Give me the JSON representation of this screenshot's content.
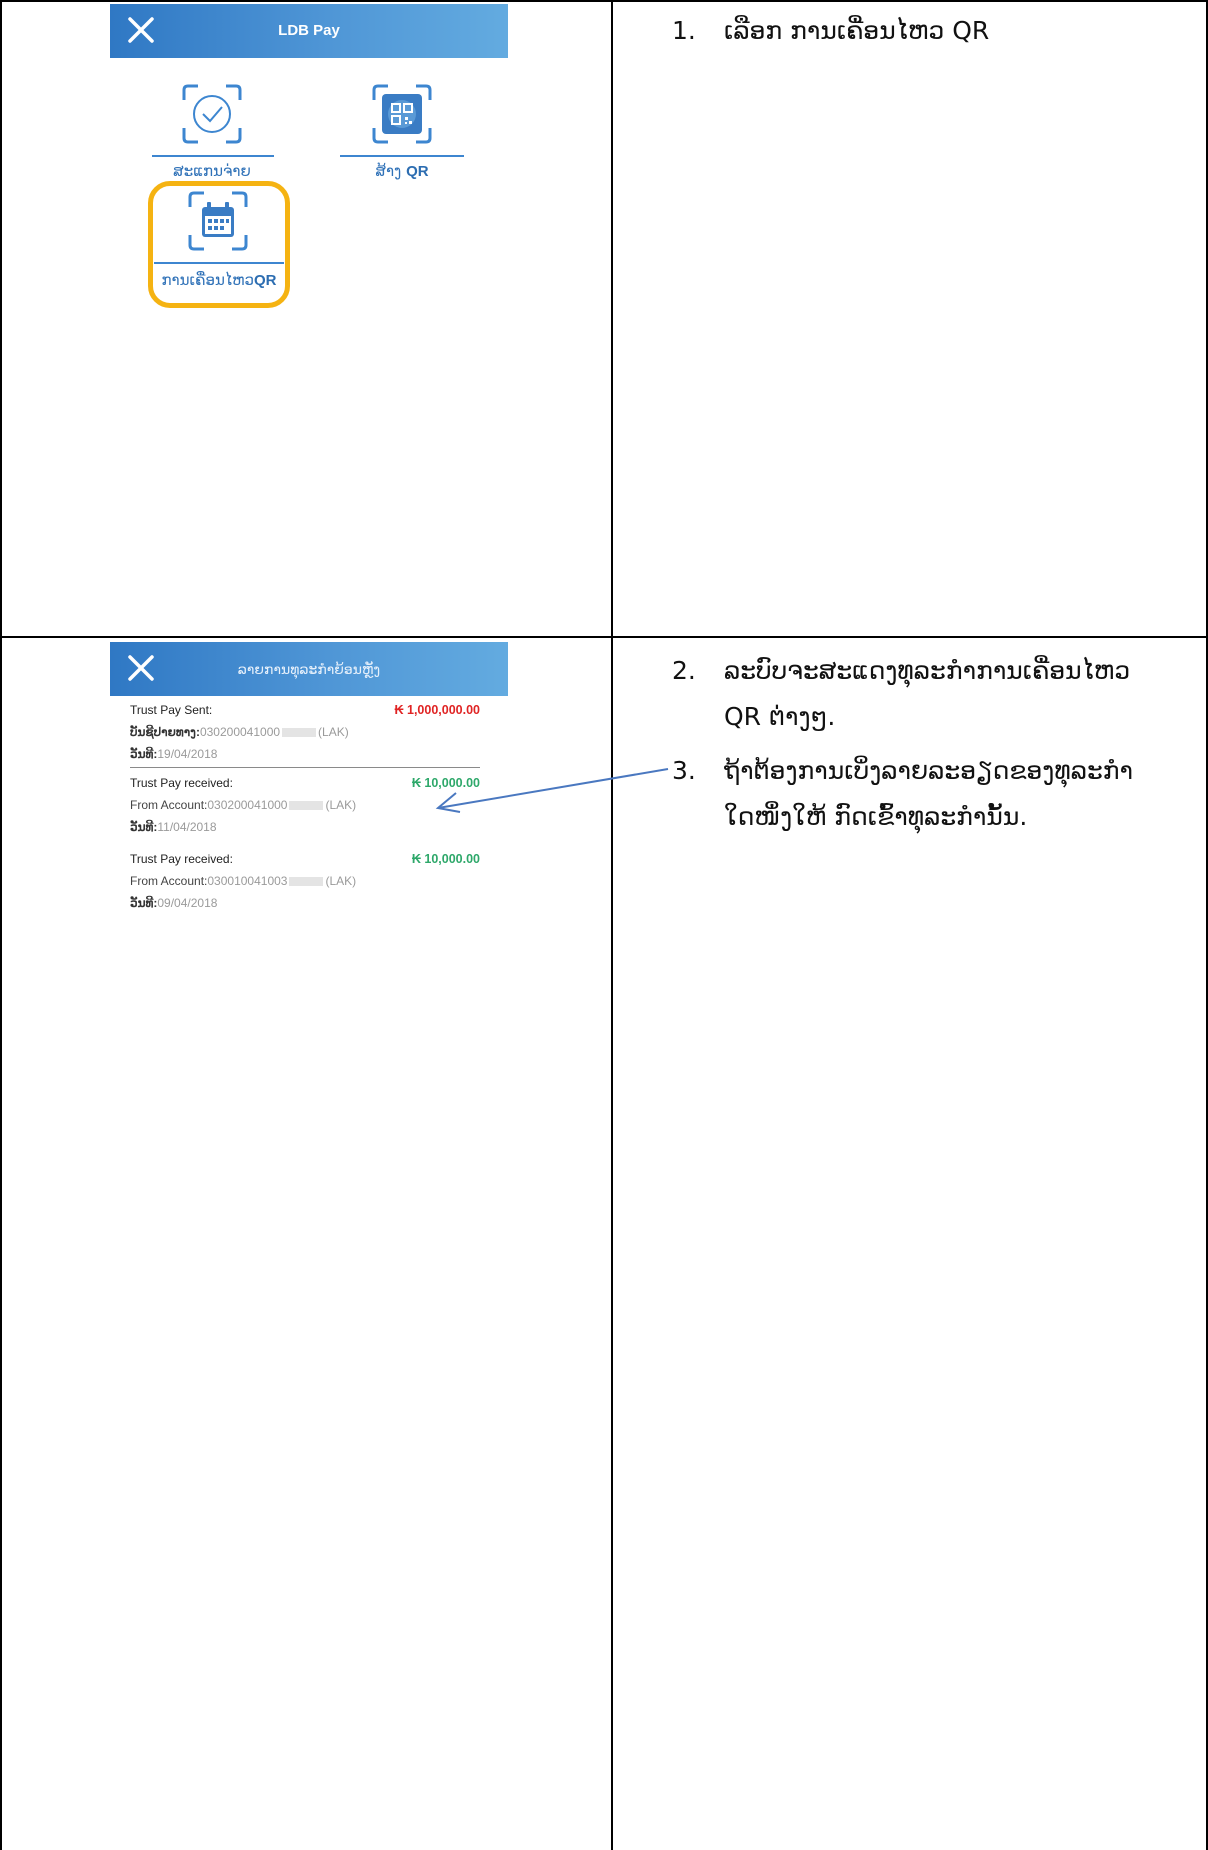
{
  "row1": {
    "header_title": "LDB Pay",
    "tiles": [
      {
        "label": "ສະແກນຈ່າຍ",
        "icon": "check-circle-icon"
      },
      {
        "label": "ສ້າງ ",
        "label_bold": "QR",
        "icon": "qr-code-icon"
      },
      {
        "label": "ການເຄື່ອນໄຫວ",
        "label_bold": "QR",
        "icon": "calendar-icon"
      }
    ],
    "instruction_num": "1.",
    "instruction_text": "ເລືອກ ການເຄື່ອນໄຫວ QR"
  },
  "row2": {
    "header_title": "ລາຍການທຸລະກຳຍ້ອນຫຼັງ",
    "transactions": [
      {
        "title": "Trust Pay Sent:",
        "amount": "₭ 1,000,000.00",
        "amount_color": "#e02424",
        "account_label": "ບັນຊີປາຍທາງ:",
        "account_value": "030200041000",
        "currency": "(LAK)",
        "date_label": "ວັນທີ:",
        "date_value": "19/04/2018"
      },
      {
        "title": "Trust Pay received:",
        "amount": "₭ 10,000.00",
        "amount_color": "#2ea86a",
        "account_label": "From Account:",
        "account_value": "030200041000",
        "currency": "(LAK)",
        "date_label": "ວັນທີ:",
        "date_value": "11/04/2018"
      },
      {
        "title": "Trust Pay received:",
        "amount": "₭ 10,000.00",
        "amount_color": "#2ea86a",
        "account_label": "From Account:",
        "account_value": "030010041003",
        "currency": "(LAK)",
        "date_label": "ວັນທີ:",
        "date_value": "09/04/2018"
      }
    ],
    "instructions": [
      {
        "num": "2.",
        "line1": "ລະບົບຈະສະແດງທຸລະກຳການເຄື່ອນໄຫວ",
        "line2": "QR ຕ່າງໆ."
      },
      {
        "num": "3.",
        "line1": "ຖ້າຕ້ອງການເບິ່ງລາຍລະອຽດຂອງທຸລະກຳ",
        "line2": "ໃດໜຶ່ງໃຫ້ ກົດເຂົ້າທຸລະກຳນັ້ນ."
      }
    ]
  },
  "colors": {
    "header": "#3f8ad0",
    "highlight": "#f5b312",
    "tile_blue": "#3d86d0",
    "arrow": "#4a78c0"
  }
}
